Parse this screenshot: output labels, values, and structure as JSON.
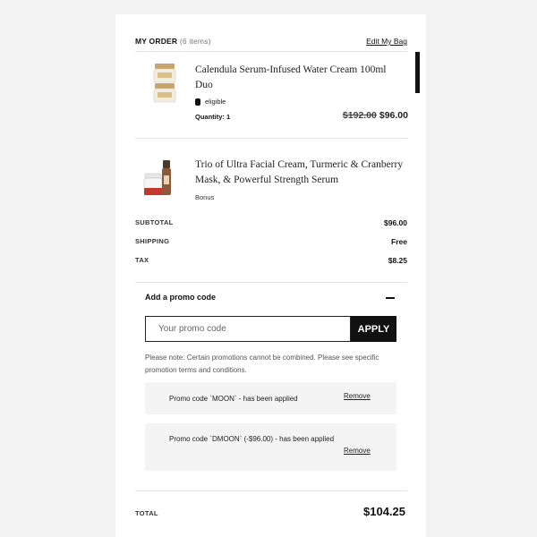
{
  "order": {
    "title": "MY ORDER",
    "count": "(6 items)",
    "edit_label": "Edit My Bag"
  },
  "items": [
    {
      "name": "Calendula Serum-Infused Water Cream 100ml Duo",
      "badge": "eligible",
      "quantity": "Quantity: 1",
      "old_price": "$192.00",
      "price": "$96.00",
      "thumb_icon": "cream-jar-duo-image"
    },
    {
      "name": "Trio of Ultra Facial Cream, Turmeric & Cranberry Mask, & Powerful Strength Serum",
      "note": "Bonus",
      "thumb_icon": "skincare-trio-image"
    }
  ],
  "summary": {
    "subtotal_label": "SUBTOTAL",
    "subtotal_value": "$96.00",
    "shipping_label": "SHIPPING",
    "shipping_value": "Free",
    "tax_label": "TAX",
    "tax_value": "$8.25",
    "total_label": "TOTAL",
    "total_value": "$104.25"
  },
  "promo": {
    "title": "Add a promo code",
    "placeholder": "Your promo code",
    "value": "",
    "apply_label": "APPLY",
    "note": "Please note: Certain promotions cannot be combined. Please see specific promotion terms and conditions.",
    "applied": [
      {
        "text": "Promo code `MOON` - has been applied",
        "remove_label": "Remove"
      },
      {
        "text": "Promo code `DMOON` (-$96.00) - has been applied",
        "remove_label": "Remove"
      }
    ]
  },
  "colors": {
    "background": "#f3f3f3",
    "panel": "#ffffff",
    "accent": "#111111",
    "applied_bg": "#f4f4f4"
  }
}
